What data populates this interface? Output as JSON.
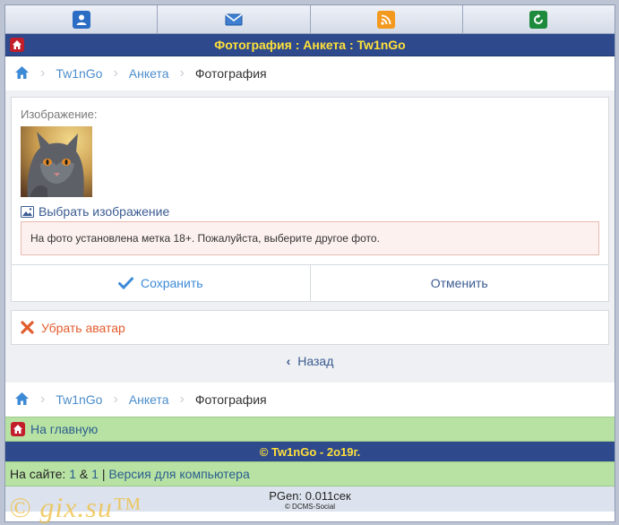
{
  "topnav": {
    "icons": [
      "profile-icon",
      "mail-icon",
      "rss-icon",
      "refresh-icon"
    ]
  },
  "header": {
    "title": "Фотография : Анкета : Tw1nGo"
  },
  "breadcrumb": {
    "items": [
      "Tw1nGo",
      "Анкета",
      "Фотография"
    ]
  },
  "form": {
    "image_label": "Изображение:",
    "choose_label": "Выбрать изображение",
    "alert_text": "На фото установлена метка 18+. Пожалуйста, выберите другое фото.",
    "save_label": "Сохранить",
    "cancel_label": "Отменить"
  },
  "remove_avatar_label": "Убрать аватар",
  "back_label": "Назад",
  "home_link_label": "На главную",
  "footer": {
    "copyright": "© Tw1nGo - 2o19г.",
    "online_prefix": "На сайте:",
    "online_count_1": "1",
    "online_amp": "&",
    "online_count_2": "1",
    "online_sep": "|",
    "desktop_link": "Версия для компьютера",
    "pgen": "PGen: 0.011сек",
    "engine": "© DCMS-Social"
  },
  "watermark": "© gix.su™",
  "colors": {
    "title_yellow": "#ffe03a",
    "header_blue": "#2e4a8c",
    "link_blue": "#4c8dcb",
    "remove_orange": "#e25d2e",
    "green_bar": "#b8e2a4"
  }
}
